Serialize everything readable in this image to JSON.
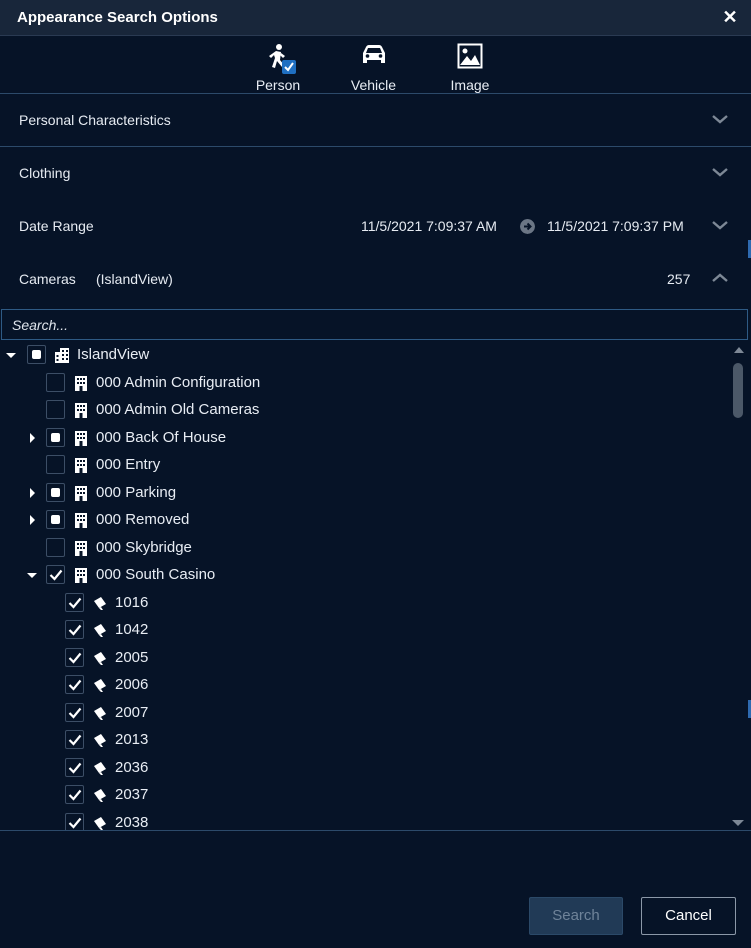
{
  "dialog": {
    "title": "Appearance Search Options",
    "close_glyph": "✕"
  },
  "search_types": [
    {
      "label": "Person",
      "icon": "person-walking-icon",
      "selected": true
    },
    {
      "label": "Vehicle",
      "icon": "car-icon",
      "selected": false
    },
    {
      "label": "Image",
      "icon": "image-icon",
      "selected": false
    }
  ],
  "sections": {
    "personal": {
      "label": "Personal Characteristics",
      "expanded": false
    },
    "clothing": {
      "label": "Clothing",
      "expanded": false
    },
    "date_range": {
      "label": "Date Range",
      "from": "11/5/2021 7:09:37 AM",
      "to": "11/5/2021 7:09:37 PM",
      "expanded": false
    },
    "cameras": {
      "label": "Cameras",
      "site": "(IslandView)",
      "count": "257",
      "expanded": true
    }
  },
  "camera_search": {
    "placeholder": "Search..."
  },
  "tree": [
    {
      "label": "IslandView",
      "level": 0,
      "expander": "expanded",
      "check": "partial",
      "icon": "site-icon"
    },
    {
      "label": "000 Admin Configuration",
      "level": 1,
      "expander": "none",
      "check": "unchecked",
      "icon": "building-icon"
    },
    {
      "label": "000 Admin Old Cameras",
      "level": 1,
      "expander": "none",
      "check": "unchecked",
      "icon": "building-icon"
    },
    {
      "label": "000 Back Of House",
      "level": 1,
      "expander": "collapsed",
      "check": "partial",
      "icon": "building-icon"
    },
    {
      "label": "000 Entry",
      "level": 1,
      "expander": "none",
      "check": "unchecked",
      "icon": "building-icon"
    },
    {
      "label": "000 Parking",
      "level": 1,
      "expander": "collapsed",
      "check": "partial",
      "icon": "building-icon"
    },
    {
      "label": "000 Removed",
      "level": 1,
      "expander": "collapsed",
      "check": "partial",
      "icon": "building-icon"
    },
    {
      "label": "000 Skybridge",
      "level": 1,
      "expander": "none",
      "check": "unchecked",
      "icon": "building-icon"
    },
    {
      "label": "000 South Casino",
      "level": 1,
      "expander": "expanded",
      "check": "checked",
      "icon": "building-icon"
    },
    {
      "label": "1016",
      "level": 2,
      "expander": "none",
      "check": "checked",
      "icon": "camera-icon"
    },
    {
      "label": "1042",
      "level": 2,
      "expander": "none",
      "check": "checked",
      "icon": "camera-icon"
    },
    {
      "label": "2005",
      "level": 2,
      "expander": "none",
      "check": "checked",
      "icon": "camera-icon"
    },
    {
      "label": "2006",
      "level": 2,
      "expander": "none",
      "check": "checked",
      "icon": "camera-icon"
    },
    {
      "label": "2007",
      "level": 2,
      "expander": "none",
      "check": "checked",
      "icon": "camera-icon"
    },
    {
      "label": "2013",
      "level": 2,
      "expander": "none",
      "check": "checked",
      "icon": "camera-icon"
    },
    {
      "label": "2036",
      "level": 2,
      "expander": "none",
      "check": "checked",
      "icon": "camera-icon"
    },
    {
      "label": "2037",
      "level": 2,
      "expander": "none",
      "check": "checked",
      "icon": "camera-icon"
    },
    {
      "label": "2038",
      "level": 2,
      "expander": "none",
      "check": "checked",
      "icon": "camera-icon"
    }
  ],
  "footer": {
    "search_label": "Search",
    "cancel_label": "Cancel"
  },
  "colors": {
    "background": "#061327",
    "titlebar": "#18263a",
    "separator": "#2c4a6a",
    "accent": "#2e6ab0",
    "check_blue": "#1f6fc1"
  }
}
